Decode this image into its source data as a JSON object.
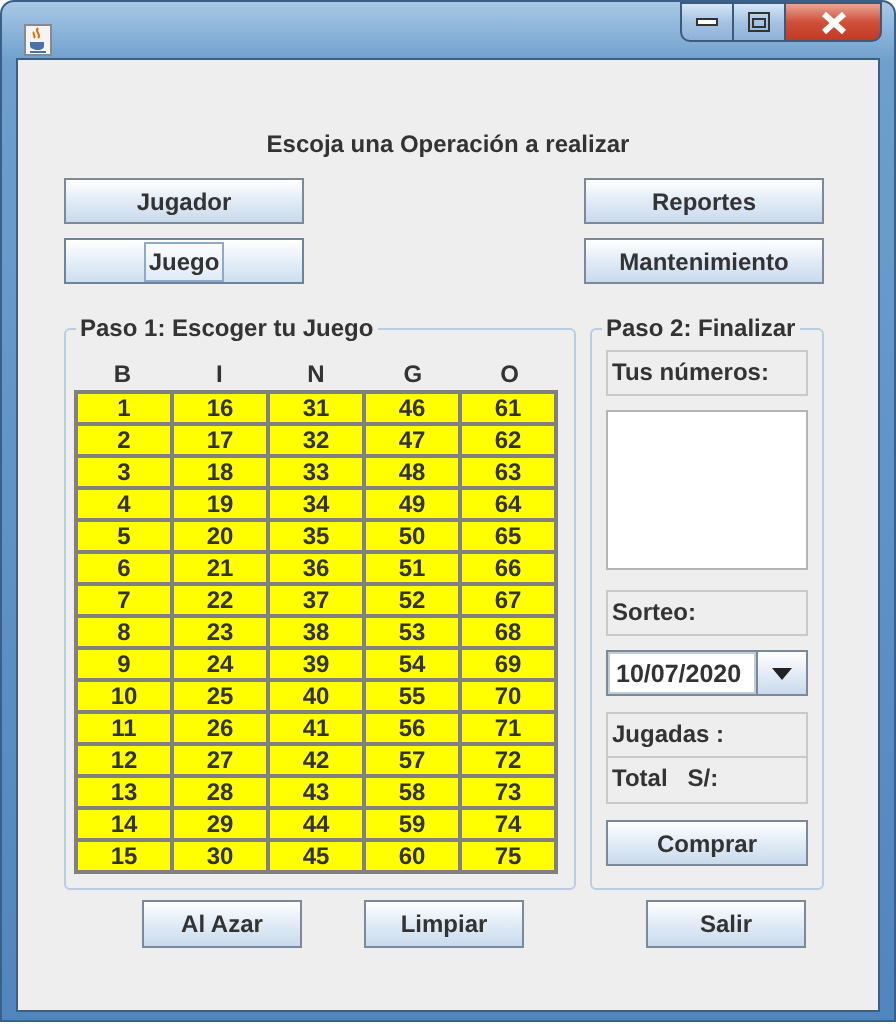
{
  "heading": "Escoja una Operación a realizar",
  "menu_buttons": [
    {
      "label": "Jugador",
      "focused": false
    },
    {
      "label": "Reportes",
      "focused": false
    },
    {
      "label": "Juego",
      "focused": true
    },
    {
      "label": "Mantenimiento",
      "focused": false
    }
  ],
  "step1": {
    "legend": "Paso 1: Escoger tu Juego",
    "columns": [
      "B",
      "I",
      "N",
      "G",
      "O"
    ],
    "rows": [
      [
        "1",
        "16",
        "31",
        "46",
        "61"
      ],
      [
        "2",
        "17",
        "32",
        "47",
        "62"
      ],
      [
        "3",
        "18",
        "33",
        "48",
        "63"
      ],
      [
        "4",
        "19",
        "34",
        "49",
        "64"
      ],
      [
        "5",
        "20",
        "35",
        "50",
        "65"
      ],
      [
        "6",
        "21",
        "36",
        "51",
        "66"
      ],
      [
        "7",
        "22",
        "37",
        "52",
        "67"
      ],
      [
        "8",
        "23",
        "38",
        "53",
        "68"
      ],
      [
        "9",
        "24",
        "39",
        "54",
        "69"
      ],
      [
        "10",
        "25",
        "40",
        "55",
        "70"
      ],
      [
        "11",
        "26",
        "41",
        "56",
        "71"
      ],
      [
        "12",
        "27",
        "42",
        "57",
        "72"
      ],
      [
        "13",
        "28",
        "43",
        "58",
        "73"
      ],
      [
        "14",
        "29",
        "44",
        "59",
        "74"
      ],
      [
        "15",
        "30",
        "45",
        "60",
        "75"
      ]
    ]
  },
  "step2": {
    "legend": "Paso 2: Finalizar",
    "numbers_label": "Tus números:",
    "draw_label": "Sorteo:",
    "draw_date": "10/07/2020",
    "plays_label": "Jugadas :",
    "total_label": "Total   S/:",
    "buy_button": "Comprar"
  },
  "bottom_buttons": [
    "Al Azar",
    "Limpiar",
    "Salir"
  ]
}
